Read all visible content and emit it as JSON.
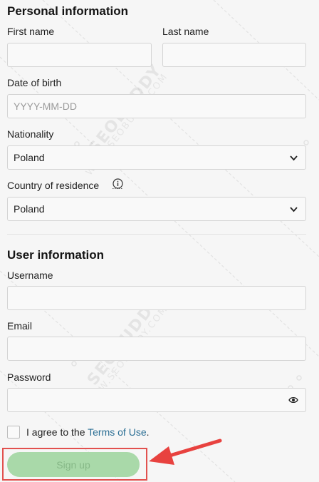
{
  "personal": {
    "title": "Personal information",
    "first_name_label": "First name",
    "last_name_label": "Last name",
    "first_name_value": "",
    "last_name_value": "",
    "dob_label": "Date of birth",
    "dob_placeholder": "YYYY-MM-DD",
    "nationality_label": "Nationality",
    "nationality_value": "Poland",
    "residence_label": "Country of residence",
    "residence_value": "Poland"
  },
  "user": {
    "title": "User information",
    "username_label": "Username",
    "email_label": "Email",
    "password_label": "Password"
  },
  "terms": {
    "prefix": "I agree to the ",
    "link": "Terms of Use",
    "suffix": "."
  },
  "signup_label": "Sign up",
  "watermark": {
    "brand": "SEOBUDDY",
    "url": "WWW.SEOBUDDY.COM"
  },
  "icons": {
    "select": "chevron-down-icon",
    "info": "info-icon",
    "password": "eye-icon"
  },
  "colors": {
    "link": "#2a6e94",
    "signup_bg": "#a9d9a9",
    "highlight": "#e2514f",
    "arrow": "#e8423f"
  }
}
